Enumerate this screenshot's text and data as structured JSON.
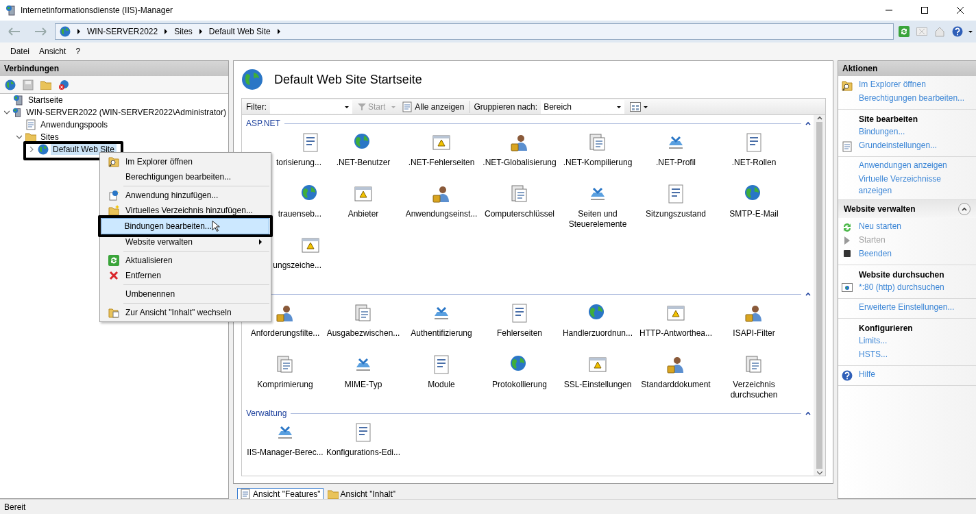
{
  "window": {
    "title": "Internetinformationsdienste (IIS)-Manager"
  },
  "address": {
    "segments": [
      "WIN-SERVER2022",
      "Sites",
      "Default Web Site"
    ]
  },
  "menu_bar": [
    "Datei",
    "Ansicht",
    "?"
  ],
  "connections": {
    "title": "Verbindungen",
    "tree": [
      {
        "label": "Startseite",
        "selected": false
      },
      {
        "label": "WIN-SERVER2022 (WIN-SERVER2022\\Administrator)",
        "selected": false,
        "expanded": true,
        "children": [
          {
            "label": "Anwendungspools",
            "selected": false
          },
          {
            "label": "Sites",
            "selected": false,
            "expanded": true,
            "children": [
              {
                "label": "Default Web Site",
                "selected": true,
                "expanded": false
              }
            ]
          }
        ]
      }
    ]
  },
  "context_menu": {
    "groups": [
      [
        {
          "label": "Im Explorer öffnen",
          "selected": false,
          "submenu": false
        },
        {
          "label": "Berechtigungen bearbeiten...",
          "selected": false,
          "submenu": false
        }
      ],
      [
        {
          "label": "Anwendung hinzufügen...",
          "selected": false,
          "submenu": false
        },
        {
          "label": "Virtuelles Verzeichnis hinzufügen...",
          "selected": false,
          "submenu": false
        },
        {
          "label": "Bindungen bearbeiten...",
          "selected": true,
          "submenu": false
        },
        {
          "label": "Website verwalten",
          "selected": false,
          "submenu": true
        }
      ],
      [
        {
          "label": "Aktualisieren",
          "selected": false,
          "submenu": false
        },
        {
          "label": "Entfernen",
          "selected": false,
          "submenu": false
        }
      ],
      [
        {
          "label": "Umbenennen",
          "selected": false,
          "submenu": false
        }
      ],
      [
        {
          "label": "Zur Ansicht \"Inhalt\" wechseln",
          "selected": false,
          "submenu": false
        }
      ]
    ]
  },
  "home": {
    "title": "Default Web Site Startseite",
    "filter": {
      "label": "Filter:",
      "start": "Start",
      "show_all": "Alle anzeigen",
      "group_by_label": "Gruppieren nach:",
      "group_by_value": "Bereich"
    },
    "groups": [
      {
        "title": "ASP.NET",
        "expanded": true,
        "features": [
          {
            "label": "torisierung...",
            "partial": true
          },
          {
            "label": ".NET-Benutzer",
            "partial": false
          },
          {
            "label": ".NET-Fehlerseiten",
            "partial": false
          },
          {
            "label": ".NET-Globalisierung",
            "partial": false
          },
          {
            "label": ".NET-Kompilierung",
            "partial": false
          },
          {
            "label": ".NET-Profil",
            "partial": false
          },
          {
            "label": ".NET-Rollen",
            "partial": false
          },
          {
            "label": "trauenseb...",
            "partial": true
          },
          {
            "label": "Anbieter",
            "partial": false
          },
          {
            "label": "Anwendungseinst...",
            "partial": false
          },
          {
            "label": "Computerschlüssel",
            "partial": false
          },
          {
            "label": "Seiten und Steuerelemente",
            "partial": false
          },
          {
            "label": "Sitzungszustand",
            "partial": false
          },
          {
            "label": "SMTP-E-Mail",
            "partial": false
          },
          {
            "label": "ungszeiche...",
            "partial": true
          }
        ]
      },
      {
        "expanded": true,
        "features": [
          {
            "label": "Anforderungsfilte...",
            "partial": false
          },
          {
            "label": "Ausgabezwischen...",
            "partial": false
          },
          {
            "label": "Authentifizierung",
            "partial": false
          },
          {
            "label": "Fehlerseiten",
            "partial": false
          },
          {
            "label": "Handlerzuordnun...",
            "partial": false
          },
          {
            "label": "HTTP-Antworthea...",
            "partial": false
          },
          {
            "label": "ISAPI-Filter",
            "partial": false
          },
          {
            "label": "Komprimierung",
            "partial": false
          },
          {
            "label": "MIME-Typ",
            "partial": false
          },
          {
            "label": "Module",
            "partial": false
          },
          {
            "label": "Protokollierung",
            "partial": false
          },
          {
            "label": "SSL-Einstellungen",
            "partial": false
          },
          {
            "label": "Standarddokument",
            "partial": false
          },
          {
            "label": "Verzeichnis durchsuchen",
            "partial": false
          }
        ]
      },
      {
        "title": "Verwaltung",
        "expanded": true,
        "features": [
          {
            "label": "IIS-Manager-Berec...",
            "partial": false
          },
          {
            "label": "Konfigurations-Edi...",
            "partial": false
          }
        ]
      }
    ],
    "view_tabs": [
      {
        "label": "Ansicht \"Features\"",
        "selected": true
      },
      {
        "label": "Ansicht \"Inhalt\"",
        "selected": false
      }
    ]
  },
  "actions": {
    "title": "Aktionen",
    "blocks": [
      {
        "kind": "section",
        "items": [
          {
            "label": "Im Explorer öffnen",
            "disabled": false
          },
          {
            "label": "Berechtigungen bearbeiten...",
            "disabled": false
          }
        ]
      },
      {
        "kind": "section",
        "title": "Site bearbeiten",
        "items": [
          {
            "label": "Bindungen...",
            "disabled": false
          },
          {
            "label": "Grundeinstellungen...",
            "disabled": false
          }
        ]
      },
      {
        "kind": "section",
        "items": [
          {
            "label": "Anwendungen anzeigen",
            "disabled": false
          },
          {
            "label": "Virtuelle Verzeichnisse anzeigen",
            "disabled": false
          }
        ]
      },
      {
        "kind": "group-header",
        "label": "Website verwalten",
        "expanded": true
      },
      {
        "kind": "section",
        "items": [
          {
            "label": "Neu starten",
            "disabled": false
          },
          {
            "label": "Starten",
            "disabled": true
          },
          {
            "label": "Beenden",
            "disabled": false
          }
        ]
      },
      {
        "kind": "section",
        "title": "Website durchsuchen",
        "items": [
          {
            "label": "*:80 (http) durchsuchen",
            "disabled": false
          }
        ]
      },
      {
        "kind": "section",
        "items": [
          {
            "label": "Erweiterte Einstellungen...",
            "disabled": false
          }
        ]
      },
      {
        "kind": "section",
        "title": "Konfigurieren",
        "items": [
          {
            "label": "Limits...",
            "disabled": false
          },
          {
            "label": "HSTS...",
            "disabled": false
          }
        ]
      },
      {
        "kind": "section",
        "items": [
          {
            "label": "Hilfe",
            "disabled": false
          }
        ]
      }
    ]
  },
  "status_bar": "Bereit"
}
